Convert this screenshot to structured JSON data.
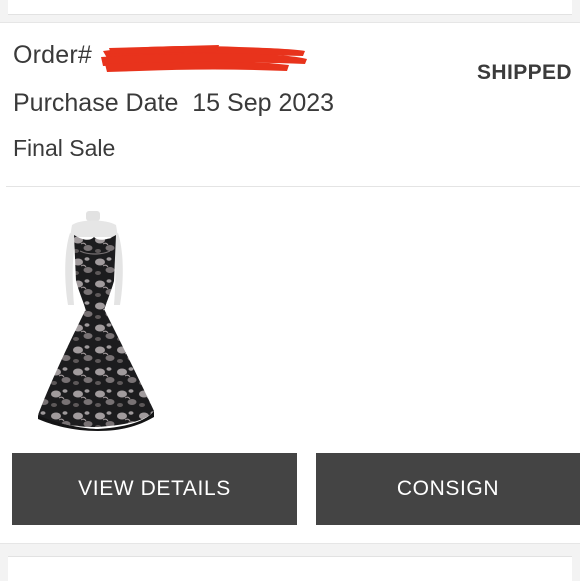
{
  "order": {
    "label": "Order#",
    "number_redacted": "",
    "status": "SHIPPED",
    "purchase_date_label": "Purchase Date",
    "purchase_date": "15 Sep 2023",
    "sale_type": "Final Sale"
  },
  "product": {
    "image_icon": "dress-on-mannequin-image"
  },
  "actions": {
    "view_details_label": "VIEW DETAILS",
    "consign_label": "CONSIGN"
  },
  "colors": {
    "button_bg": "#444444",
    "button_text": "#ffffff",
    "text_primary": "#3a3a3a",
    "redaction": "#e8331c"
  }
}
